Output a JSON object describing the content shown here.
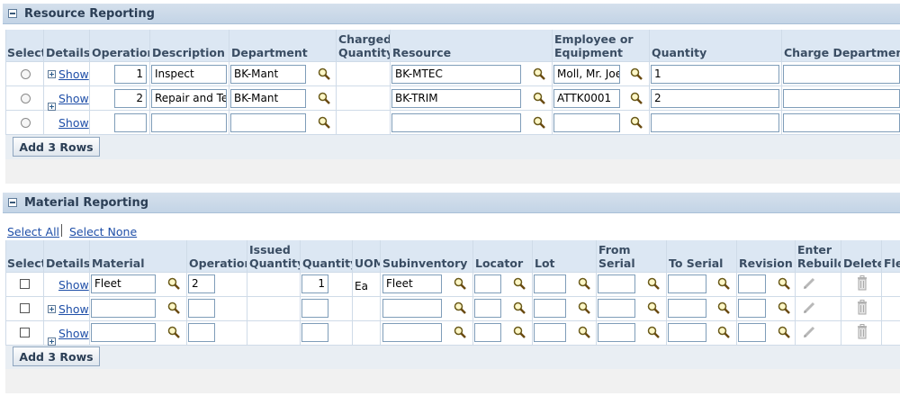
{
  "resource": {
    "title": "Resource Reporting",
    "headers": {
      "select": "Select",
      "details": "Details",
      "operation": "Operation",
      "description": "Description",
      "department": "Department",
      "charged_l1": "Charged",
      "charged_l2": "Quantity",
      "resource": "Resource",
      "employee_l1": "Employee or",
      "employee_l2": "Equipment",
      "quantity": "Quantity",
      "charge_department": "Charge Department"
    },
    "show_label": "Show",
    "rows": [
      {
        "operation": "1",
        "description": "Inspect",
        "department": "BK-Mant",
        "resource": "BK-MTEC",
        "employee": "Moll, Mr. Joe",
        "quantity": "1"
      },
      {
        "operation": "2",
        "description": "Repair and Test",
        "department": "BK-Mant",
        "resource": "BK-TRIM",
        "employee": "ATTK0001",
        "quantity": "2"
      },
      {
        "operation": "",
        "description": "",
        "department": "",
        "resource": "",
        "employee": "",
        "quantity": ""
      }
    ],
    "add_rows_label": "Add 3 Rows"
  },
  "material": {
    "title": "Material Reporting",
    "select_all": "Select All",
    "select_none": "Select None",
    "headers": {
      "select": "Select",
      "details": "Details",
      "material": "Material",
      "operation": "Operation",
      "issued_l1": "Issued",
      "issued_l2": "Quantity",
      "quantity": "Quantity",
      "uom": "UOM",
      "subinventory": "Subinventory",
      "locator": "Locator",
      "lot": "Lot",
      "from_serial": "From Serial",
      "to_serial": "To Serial",
      "revision": "Revision",
      "enter_l1": "Enter",
      "enter_l2": "Rebuild",
      "delete": "Delete",
      "flex": "Flex"
    },
    "show_label": "Show",
    "rows": [
      {
        "material": "Fleet",
        "operation": "2",
        "quantity": "1",
        "uom": "Ea",
        "subinventory": "Fleet"
      },
      {
        "material": "",
        "operation": "",
        "quantity": "",
        "uom": "",
        "subinventory": ""
      },
      {
        "material": "",
        "operation": "",
        "quantity": "",
        "uom": "",
        "subinventory": ""
      }
    ],
    "add_rows_label": "Add 3 Rows"
  },
  "icons": {
    "search": "magnifier-icon",
    "edit": "pencil-icon",
    "delete": "trash-icon"
  }
}
